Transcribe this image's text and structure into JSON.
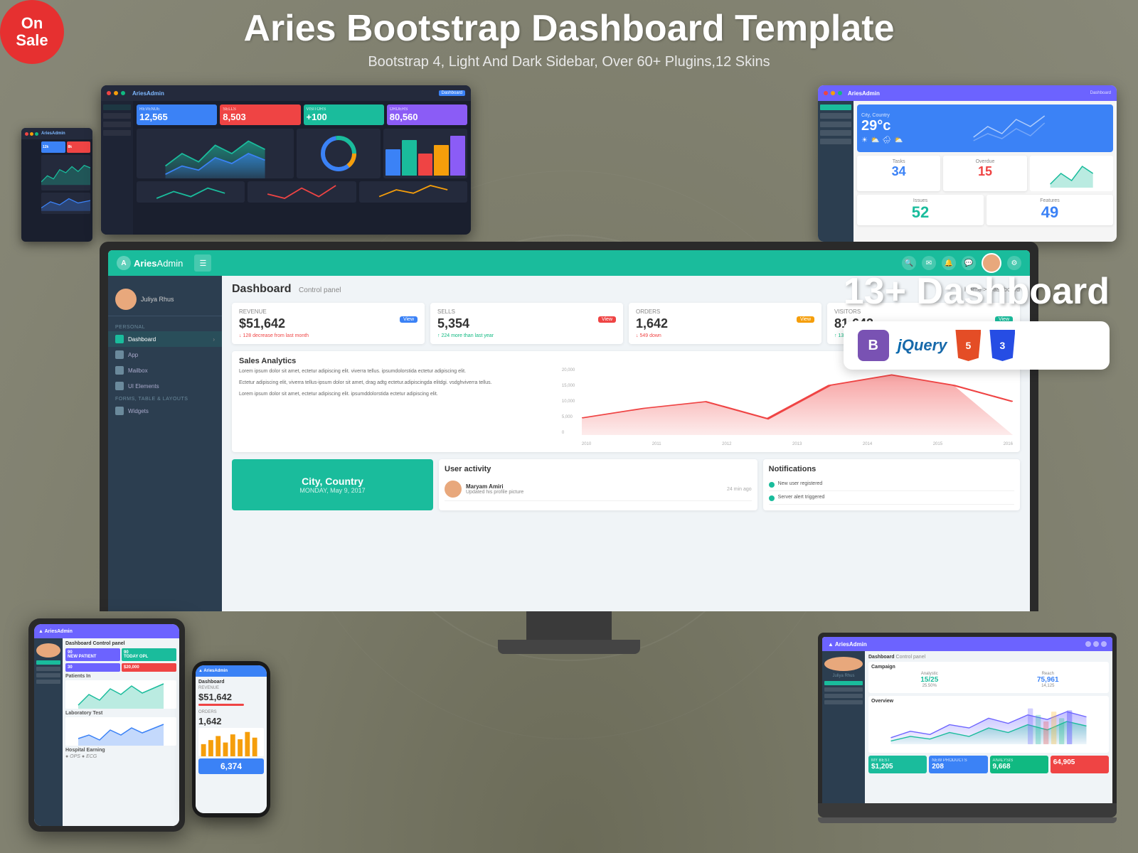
{
  "page": {
    "bg_color": "#8b8875"
  },
  "badge": {
    "line1": "On",
    "line2": "Sale"
  },
  "header": {
    "title": "Aries Bootstrap Dashboard Template",
    "subtitle": "Bootstrap 4, Light And Dark Sidebar, Over 60+ Plugins,12 Skins"
  },
  "right_info": {
    "dashboard_count": "13+ Dashboard",
    "tech_labels": [
      "Bootstrap",
      "jQuery",
      "HTML5",
      "CSS3"
    ]
  },
  "main_dashboard": {
    "app_name": "Aries",
    "app_name2": "Admin",
    "page_title": "Dashboard",
    "page_subtitle": "Control panel",
    "breadcrumb": "Home > Dashboard",
    "user_name": "Juliya Rhus",
    "nav_items": [
      "Dashboard",
      "App",
      "Mailbox",
      "UI Elements",
      "Widgets"
    ],
    "section_labels": [
      "PERSONAL",
      "FORMS, TABLE & LAYOUTS"
    ],
    "stats": [
      {
        "label": "REVENUE",
        "value": "$51,642",
        "change": "↓ 128 decrease from last month",
        "change_type": "down",
        "badge": "View"
      },
      {
        "label": "SELLS",
        "value": "5,354",
        "change": "↑ 224 more than last year",
        "change_type": "up",
        "badge": "View"
      },
      {
        "label": "ORDERS",
        "value": "1,642",
        "change": "↓ 549 down",
        "change_type": "down",
        "badge": "View"
      },
      {
        "label": "VISITORS",
        "value": "81,642",
        "change": "↑ 137 up",
        "change_type": "up",
        "badge": "View"
      }
    ],
    "analytics": {
      "title": "Sales Analytics",
      "description": "Lorem ipsum dolor sit amet, ectetur adipiscing elit. viverra tellus. ipsumdolorstida ectetur adipiscing elit.",
      "description2": "Ectetur adipiscing elit, viverra tellus-ipsum dolor sit amet, drag adtg ectetur.adipiscingda elitdgi. vsdghviverra tellus.",
      "description3": "Lorem ipsum dolor sit amet, ectetur adipiscing elit. ipsumddolorstida ectetur adipiscing elit.",
      "chart_years": [
        "2010",
        "2011",
        "2012",
        "2013",
        "2014",
        "2015",
        "2016"
      ],
      "chart_values": [
        5000,
        8000,
        12000,
        7000,
        15000,
        18000,
        14000
      ]
    },
    "city_card": {
      "name": "City, Country",
      "date": "MONDAY, May 9, 2017"
    },
    "activity": {
      "title": "User activity",
      "items": [
        {
          "name": "Maryam Amiri",
          "desc": "Updated his profile picture",
          "time": "24 min ago"
        }
      ]
    },
    "notifications": {
      "title": "Notifications",
      "items": [
        {
          "text": "New user registered"
        },
        {
          "text": "Server alert triggered"
        }
      ]
    }
  },
  "top_left_dash": {
    "stats": [
      {
        "value": "12,565",
        "color": "blue"
      },
      {
        "value": "8,503",
        "color": "red"
      },
      {
        "value": "80,560",
        "color": "teal"
      }
    ]
  },
  "top_right_dash": {
    "city": "City, Country",
    "temp": "29°c",
    "tasks": {
      "label": "Tasks",
      "value": "34"
    },
    "overdue": {
      "label": "Overdue",
      "value": "15"
    },
    "issues": {
      "label": "Issues",
      "value": "52"
    },
    "features": {
      "label": "Features",
      "value": "49"
    }
  },
  "laptop_dash": {
    "stats": [
      {
        "label": "Analystic",
        "value": "15/25",
        "change": "25.50%"
      },
      {
        "label": "",
        "value": "75,961",
        "change": "14,125"
      }
    ],
    "bottom_stats": [
      {
        "label": "MY BEST",
        "value": "$1,205"
      },
      {
        "label": "NEW PRODUCTS",
        "value": "208"
      },
      {
        "label": "ANALYSIS",
        "value": "9,668"
      },
      {
        "label": "",
        "value": "64,905"
      }
    ]
  },
  "phone_dash": {
    "title": "Dashboard",
    "revenue_value": "$51,642",
    "orders_value": "1,642",
    "bottom_num": "6,374"
  },
  "tablet_dash": {
    "title": "Dashboard Control panel",
    "stats": [
      {
        "label": "90 NEW PATIENT",
        "color": "purple"
      },
      {
        "label": "90 TODAY OPL",
        "color": "teal"
      },
      {
        "label": "30",
        "color": "purple"
      },
      {
        "label": "$20,000",
        "color": "red"
      }
    ]
  }
}
